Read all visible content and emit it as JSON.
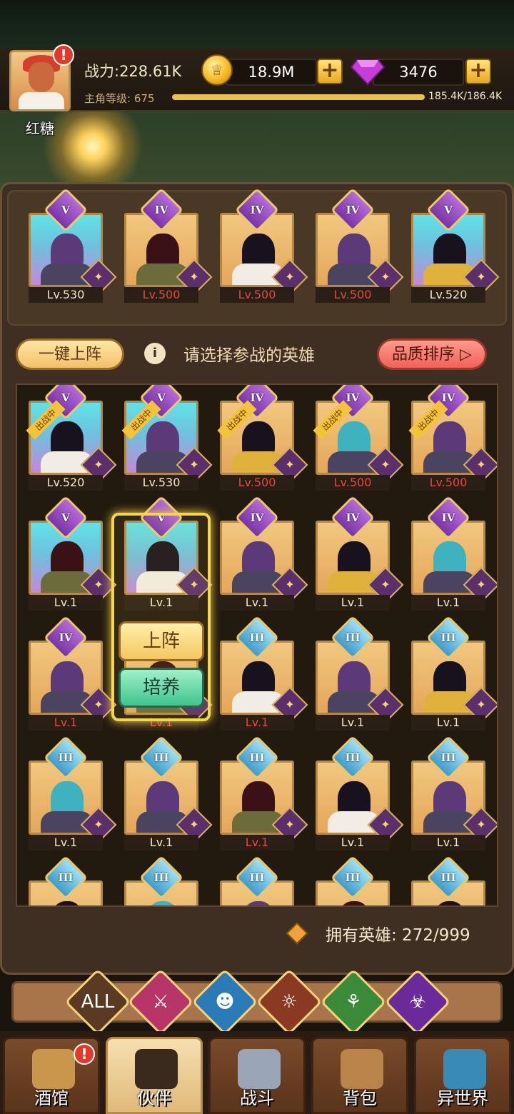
{
  "player": {
    "name": "红糖",
    "power": "战力:228.61K",
    "level_label": "主角等级: 675",
    "xp": "185.4K/186.4K",
    "xp_fraction": 0.995
  },
  "resources": {
    "gold": "18.9M",
    "gems": "3476"
  },
  "team": [
    {
      "rank": "V",
      "level": "Lv.530",
      "bg": "cyan",
      "lv_red": false
    },
    {
      "rank": "IV",
      "level": "Lv.500",
      "bg": "gold",
      "lv_red": true
    },
    {
      "rank": "IV",
      "level": "Lv.500",
      "bg": "gold",
      "lv_red": true
    },
    {
      "rank": "IV",
      "level": "Lv.500",
      "bg": "gold",
      "lv_red": true
    },
    {
      "rank": "V",
      "level": "Lv.520",
      "bg": "cyan",
      "lv_red": false
    }
  ],
  "controls": {
    "auto_deploy": "一键上阵",
    "hint": "请选择参战的英雄",
    "sort": "品质排序"
  },
  "badge": {
    "in_battle": "出战中"
  },
  "roster": [
    {
      "rank": "V",
      "level": "Lv.520",
      "bg": "cyan",
      "in_battle": true,
      "lv_red": false
    },
    {
      "rank": "V",
      "level": "Lv.530",
      "bg": "cyan",
      "in_battle": true,
      "lv_red": false
    },
    {
      "rank": "IV",
      "level": "Lv.500",
      "bg": "gold",
      "in_battle": true,
      "lv_red": true
    },
    {
      "rank": "IV",
      "level": "Lv.500",
      "bg": "gold",
      "in_battle": true,
      "lv_red": true
    },
    {
      "rank": "IV",
      "level": "Lv.500",
      "bg": "gold",
      "in_battle": true,
      "lv_red": true
    },
    {
      "rank": "V",
      "level": "Lv.1",
      "bg": "cyan",
      "in_battle": false,
      "lv_red": false
    },
    {
      "rank": "V",
      "level": "Lv.1",
      "bg": "cyan",
      "in_battle": false,
      "lv_red": false
    },
    {
      "rank": "IV",
      "level": "Lv.1",
      "bg": "gold",
      "in_battle": false,
      "lv_red": false
    },
    {
      "rank": "IV",
      "level": "Lv.1",
      "bg": "gold",
      "in_battle": false,
      "lv_red": false
    },
    {
      "rank": "IV",
      "level": "Lv.1",
      "bg": "gold",
      "in_battle": false,
      "lv_red": false
    },
    {
      "rank": "IV",
      "level": "Lv.1",
      "bg": "gold",
      "in_battle": false,
      "lv_red": true
    },
    {
      "rank": "",
      "level": "Lv.1",
      "bg": "gold",
      "in_battle": false,
      "lv_red": true
    },
    {
      "rank": "III",
      "level": "Lv.1",
      "bg": "gold",
      "in_battle": false,
      "lv_red": true
    },
    {
      "rank": "III",
      "level": "Lv.1",
      "bg": "gold",
      "in_battle": false,
      "lv_red": false
    },
    {
      "rank": "III",
      "level": "Lv.1",
      "bg": "gold",
      "in_battle": false,
      "lv_red": false
    },
    {
      "rank": "III",
      "level": "Lv.1",
      "bg": "gold",
      "in_battle": false,
      "lv_red": false
    },
    {
      "rank": "III",
      "level": "Lv.1",
      "bg": "gold",
      "in_battle": false,
      "lv_red": false
    },
    {
      "rank": "III",
      "level": "Lv.1",
      "bg": "gold",
      "in_battle": false,
      "lv_red": true
    },
    {
      "rank": "III",
      "level": "Lv.1",
      "bg": "gold",
      "in_battle": false,
      "lv_red": false
    },
    {
      "rank": "III",
      "level": "Lv.1",
      "bg": "gold",
      "in_battle": false,
      "lv_red": false
    },
    {
      "rank": "III",
      "level": "",
      "bg": "gold",
      "in_battle": false,
      "lv_red": false
    },
    {
      "rank": "III",
      "level": "",
      "bg": "gold",
      "in_battle": false,
      "lv_red": false
    },
    {
      "rank": "III",
      "level": "",
      "bg": "gold",
      "in_battle": false,
      "lv_red": false
    },
    {
      "rank": "III",
      "level": "",
      "bg": "gold",
      "in_battle": false,
      "lv_red": false
    },
    {
      "rank": "III",
      "level": "",
      "bg": "gold",
      "in_battle": false,
      "lv_red": false
    }
  ],
  "actions": {
    "deploy": "上阵",
    "train": "培养"
  },
  "owned": "拥有英雄: 272/999",
  "filters": {
    "all": "ALL"
  },
  "nav": [
    {
      "label": "酒馆",
      "icon": "tavern-mug-icon",
      "alert": true
    },
    {
      "label": "伙伴",
      "icon": "partner-face-icon",
      "alert": false
    },
    {
      "label": "战斗",
      "icon": "crossed-swords-icon",
      "alert": false
    },
    {
      "label": "背包",
      "icon": "backpack-icon",
      "alert": false
    },
    {
      "label": "异世界",
      "icon": "portal-icon",
      "alert": false
    }
  ]
}
